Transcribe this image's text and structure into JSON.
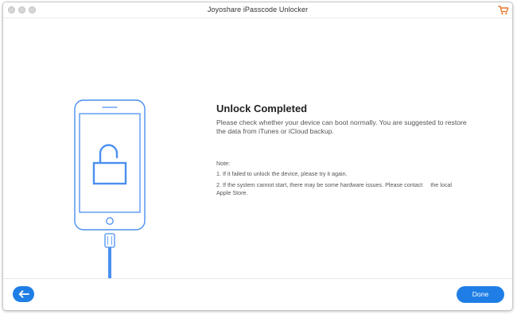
{
  "window": {
    "title": "Joyoshare iPasscode Unlocker"
  },
  "icons": {
    "cart": "shopping-cart-icon",
    "back": "arrow-left-icon",
    "lock": "unlocked-padlock-icon"
  },
  "main": {
    "heading": "Unlock Completed",
    "description": "Please check whether your device can boot normally. You are suggested to restore the data from iTunes or iCloud backup.",
    "note_title": "Note:",
    "notes": [
      "1. If it failed to unlock the device, please try it again.",
      "2. If the system cannot start, there may be some hardware issues. Please contact     the local Apple Store."
    ]
  },
  "footer": {
    "done_label": "Done"
  },
  "colors": {
    "accent": "#1f7ee6",
    "illustration_stroke": "#4a8ff0",
    "cart": "#e8772c"
  }
}
